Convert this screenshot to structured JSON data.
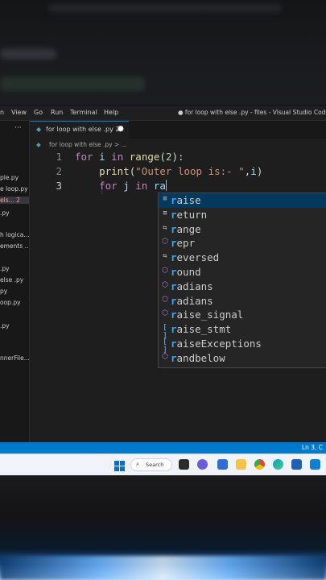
{
  "menubar": {
    "items": [
      "n",
      "View",
      "Go",
      "Run",
      "Terminal",
      "Help"
    ],
    "window_title": "● for loop with else .py - files - Visual Studio Code"
  },
  "sidebar": {
    "files": [
      "ple.py",
      "e loop.py",
      "els... 2",
      ".py",
      "h logica...",
      "ements ...",
      ".py",
      "else .py",
      "py",
      "oop.py",
      ".py",
      "nnerFile..."
    ]
  },
  "tab": {
    "label": "for loop with else .py 2",
    "modified_dot": "●"
  },
  "breadcrumb": "for loop with else .py > ...",
  "editor": {
    "line_numbers": [
      "1",
      "2",
      "3"
    ],
    "lines": [
      "for i in range(2):",
      "    print(\"Outer loop is:- \",i)",
      "    for j in ra"
    ]
  },
  "suggestions": [
    {
      "label": "raise",
      "kind": "keyword",
      "selected": true
    },
    {
      "label": "return",
      "kind": "keyword"
    },
    {
      "label": "range",
      "kind": "class"
    },
    {
      "label": "repr",
      "kind": "function"
    },
    {
      "label": "reversed",
      "kind": "class"
    },
    {
      "label": "round",
      "kind": "function"
    },
    {
      "label": "radians",
      "kind": "function"
    },
    {
      "label": "radians",
      "kind": "function"
    },
    {
      "label": "raise_signal",
      "kind": "function"
    },
    {
      "label": "raise_stmt",
      "kind": "variable"
    },
    {
      "label": "raiseExceptions",
      "kind": "variable"
    },
    {
      "label": "randbelow",
      "kind": "function"
    }
  ],
  "statusbar": {
    "position": "Ln 3, C"
  },
  "taskbar": {
    "search_label": "Search"
  },
  "colors": {
    "accent": "#007acc",
    "selection": "#04395e",
    "match": "#2aaaff"
  }
}
